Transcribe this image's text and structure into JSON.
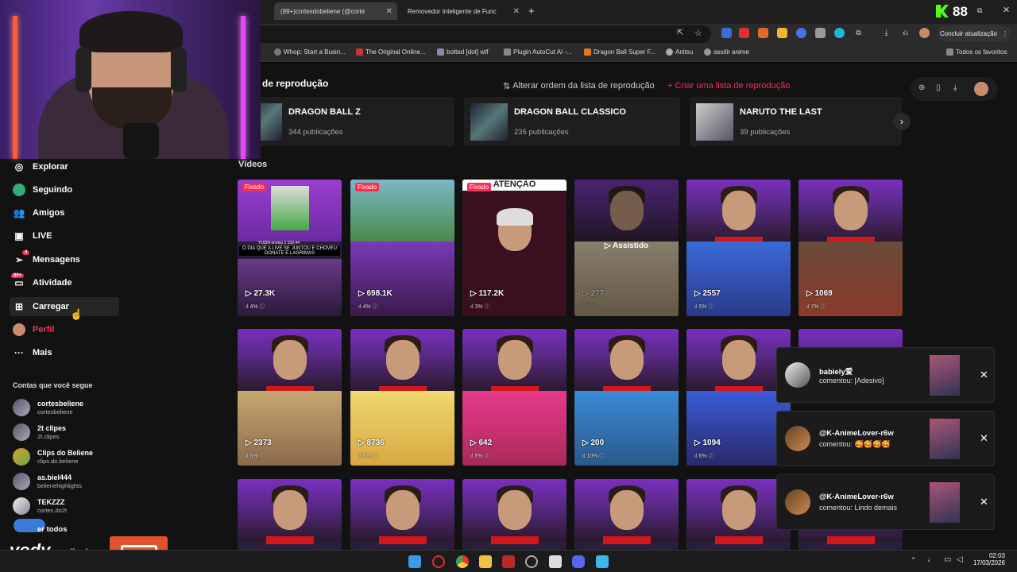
{
  "browser": {
    "tabs": [
      {
        "label": "(99+)cortesdobeliene (@corte",
        "active": true
      },
      {
        "label": "Removedor Inteligente de Func",
        "active": false
      }
    ],
    "update_button": "Concluir atualização",
    "bookmarks": [
      "Whop: Start a Busin...",
      "The Original Online...",
      "botted [dot] wtf",
      "Plugin AutoCut AI -...",
      "Dragon Ball Super F...",
      "Anitsu",
      "assitir anime"
    ],
    "bookmarks_folder": "Todos os favoritos",
    "overlay_counter": "88"
  },
  "sidebar": {
    "items": [
      {
        "label": "Explorar",
        "icon": "compass-icon"
      },
      {
        "label": "Seguindo",
        "icon": "following-icon"
      },
      {
        "label": "Amigos",
        "icon": "friends-icon"
      },
      {
        "label": "LIVE",
        "icon": "live-icon"
      },
      {
        "label": "Mensagens",
        "icon": "messages-icon",
        "badge": "4"
      },
      {
        "label": "Atividade",
        "icon": "activity-icon",
        "badge": "99+"
      },
      {
        "label": "Carregar",
        "icon": "upload-icon"
      },
      {
        "label": "Perfil",
        "icon": "avatar-icon"
      },
      {
        "label": "Mais",
        "icon": "more-icon"
      }
    ],
    "following_title": "Contas que você segue",
    "following": [
      {
        "name": "cortesbeliene",
        "handle": "cortesbeliene"
      },
      {
        "name": "2t clipes",
        "handle": "2t.clipes"
      },
      {
        "name": "Clips do Beliene",
        "handle": "clips.do.beliene"
      },
      {
        "name": "as.biel444",
        "handle": "belienehighlights"
      },
      {
        "name": "TEKZZZ",
        "handle": "cortes.do2t"
      }
    ],
    "see_all": "er todos"
  },
  "playlists": {
    "section_label": "de reprodução",
    "reorder": "Alterar ordem da lista de reprodução",
    "create": "Criar uma lista de reprodução",
    "items": [
      {
        "title": "DRAGON BALL Z",
        "count": "344 publicações"
      },
      {
        "title": "DRAGON BALL CLASSICO",
        "count": "235 publicações"
      },
      {
        "title": "NARUTO THE LAST",
        "count": "39 publicações"
      }
    ]
  },
  "videos": {
    "section_label": "Vídeos",
    "pinned_label": "Fixado",
    "watched_label": "Assistido",
    "row1": [
      {
        "views": "27.3K",
        "pct": "4%",
        "pinned": true,
        "caption": "O DIA QUE A LIVE SE JUNTOU E CHOVEU DONATE E LAGRIMAS",
        "overlay": "YUZIN enviou 1 102,44"
      },
      {
        "views": "698.1K",
        "pct": "4%",
        "pinned": true
      },
      {
        "views": "117.2K",
        "pct": "3%",
        "pinned": true,
        "banner": "ATENÇÃO"
      },
      {
        "views": "277",
        "pct": "4%",
        "watched": true
      },
      {
        "views": "2557",
        "pct": "5%"
      },
      {
        "views": "1069",
        "pct": "7%"
      }
    ],
    "row2": [
      {
        "views": "2373",
        "pct": "6%"
      },
      {
        "views": "8736",
        "pct": "5%"
      },
      {
        "views": "642",
        "pct": "5%"
      },
      {
        "views": "200",
        "pct": "10%"
      },
      {
        "views": "1094",
        "pct": "6%"
      }
    ]
  },
  "notifications": [
    {
      "name": "babiely爱",
      "text": "comentou: [Adesivo]"
    },
    {
      "name": "@K-AnimeLover-r6w",
      "text": "comentou: 🥰🥰🥰🥰"
    },
    {
      "name": "@K-AnimeLover-r6w",
      "text": "comentou: Lindo demais"
    }
  ],
  "watermark": {
    "brand": "vody.",
    "suffix": "GG",
    "path": "/bel"
  },
  "taskbar": {
    "time": "02:03",
    "date": "17/03/2026"
  },
  "colors": {
    "accent": "#fe2c55",
    "bg": "#121212",
    "card": "#1e1e1e"
  }
}
